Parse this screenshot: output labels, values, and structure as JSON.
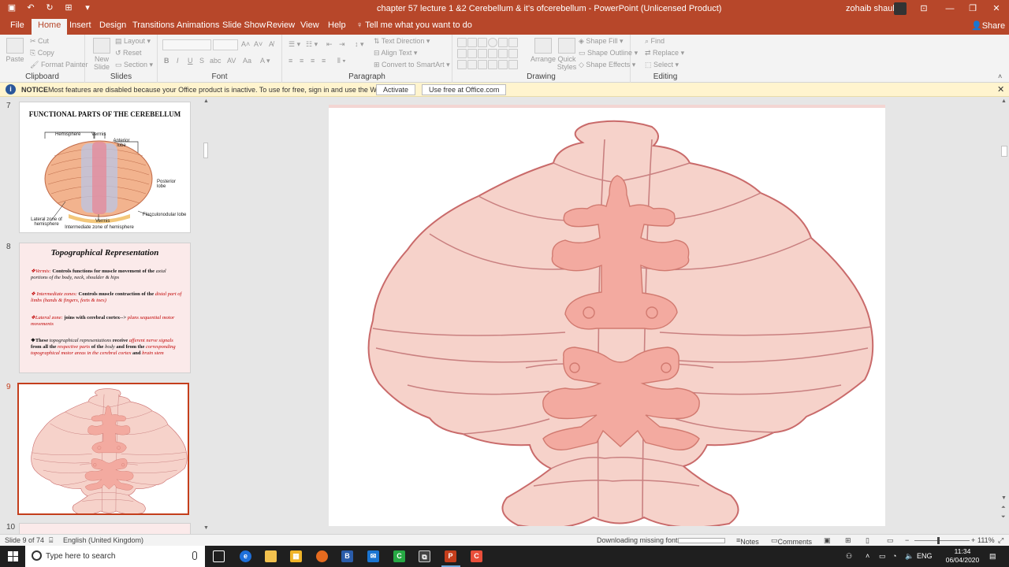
{
  "titlebar": {
    "doc_title": "chapter 57 lecture 1 &2  Cerebellum & it's ofcerebellum  -  PowerPoint (Unlicensed Product)",
    "user": "zohaib shaukat"
  },
  "tabs": [
    "File",
    "Home",
    "Insert",
    "Design",
    "Transitions",
    "Animations",
    "Slide Show",
    "Review",
    "View",
    "Help"
  ],
  "active_tab": "Home",
  "tell_me": "Tell me what you want to do",
  "share": "Share",
  "ribbon": {
    "clipboard": {
      "label": "Clipboard",
      "paste": "Paste",
      "cut": "Cut",
      "copy": "Copy",
      "format_painter": "Format Painter"
    },
    "slides": {
      "label": "Slides",
      "new_slide": "New Slide",
      "layout": "Layout",
      "reset": "Reset",
      "section": "Section"
    },
    "font": {
      "label": "Font",
      "bold": "B",
      "italic": "I",
      "underline": "U",
      "strike": "S",
      "shadow": "abc"
    },
    "paragraph": {
      "label": "Paragraph",
      "text_direction": "Text Direction",
      "align_text": "Align Text",
      "smartart": "Convert to SmartArt"
    },
    "drawing": {
      "label": "Drawing",
      "arrange": "Arrange",
      "quick_styles": "Quick Styles",
      "shape_fill": "Shape Fill",
      "shape_outline": "Shape Outline",
      "shape_effects": "Shape Effects"
    },
    "editing": {
      "label": "Editing",
      "find": "Find",
      "replace": "Replace",
      "select": "Select"
    }
  },
  "notice": {
    "heading": "NOTICE",
    "message": "Most features are disabled because your Office product is inactive. To use for free, sign in and use the Web version.",
    "activate": "Activate",
    "use_free": "Use free at Office.com"
  },
  "thumbnails": {
    "slide7": {
      "number": "7",
      "title": "FUNCTIONAL PARTS OF THE CEREBELLUM",
      "labels": {
        "hemisphere": "Hemisphere",
        "vermis_top": "Vermis",
        "anterior": "Anterior lobe",
        "posterior": "Posterior lobe",
        "lateral": "Lateral zone of hemisphere",
        "vermis_bottom": "Vermis",
        "flocculonodular": "Flocculonodular lobe",
        "intermediate": "Intermediate zone of hemisphere"
      }
    },
    "slide8": {
      "number": "8",
      "title": "Topographical Representation",
      "p1_term": "❖Vermis:",
      "p1_text": " Controls functions for muscle movement of the ",
      "p1_italic": "axial portions of the body, neck, shoulder & hips",
      "p2_term": "❖ Intermediate zones:",
      "p2_text": " Controls muscle contraction of the ",
      "p2_italic": "distal part of limbs (hands & fingers, feets & toes)",
      "p3_term": "❖Lateral zone:",
      "p3_text": " joins with cerebral cortex--> ",
      "p3_italic": "plans sequential motor movements",
      "p4_a": "❖These ",
      "p4_b": "topographical representations",
      "p4_c": " receive ",
      "p4_d": "afferent nerve signals",
      "p4_e": " from all the ",
      "p4_f": "respective parts",
      "p4_g": " of the ",
      "p4_h": "body",
      "p4_i": " and from the ",
      "p4_j": "corresponding topographical motor areas in the cerebral cortex",
      "p4_k": " and ",
      "p4_l": "brain stem"
    },
    "slide9": {
      "number": "9"
    },
    "slide10": {
      "number": "10"
    }
  },
  "status": {
    "slide_of": "Slide 9 of 74",
    "language": "English (United Kingdom)",
    "downloading": "Downloading missing fonts...",
    "notes": "Notes",
    "comments": "Comments",
    "zoom": "111%"
  },
  "taskbar": {
    "search_placeholder": "Type here to search",
    "lang": "ENG",
    "time": "11:34",
    "date": "06/04/2020"
  },
  "colors": {
    "accent": "#b7472a",
    "cerebellum_fill": "#f6d2ca",
    "cerebellum_stroke": "#c96a6a",
    "homunculus": "#f3aaa0"
  }
}
